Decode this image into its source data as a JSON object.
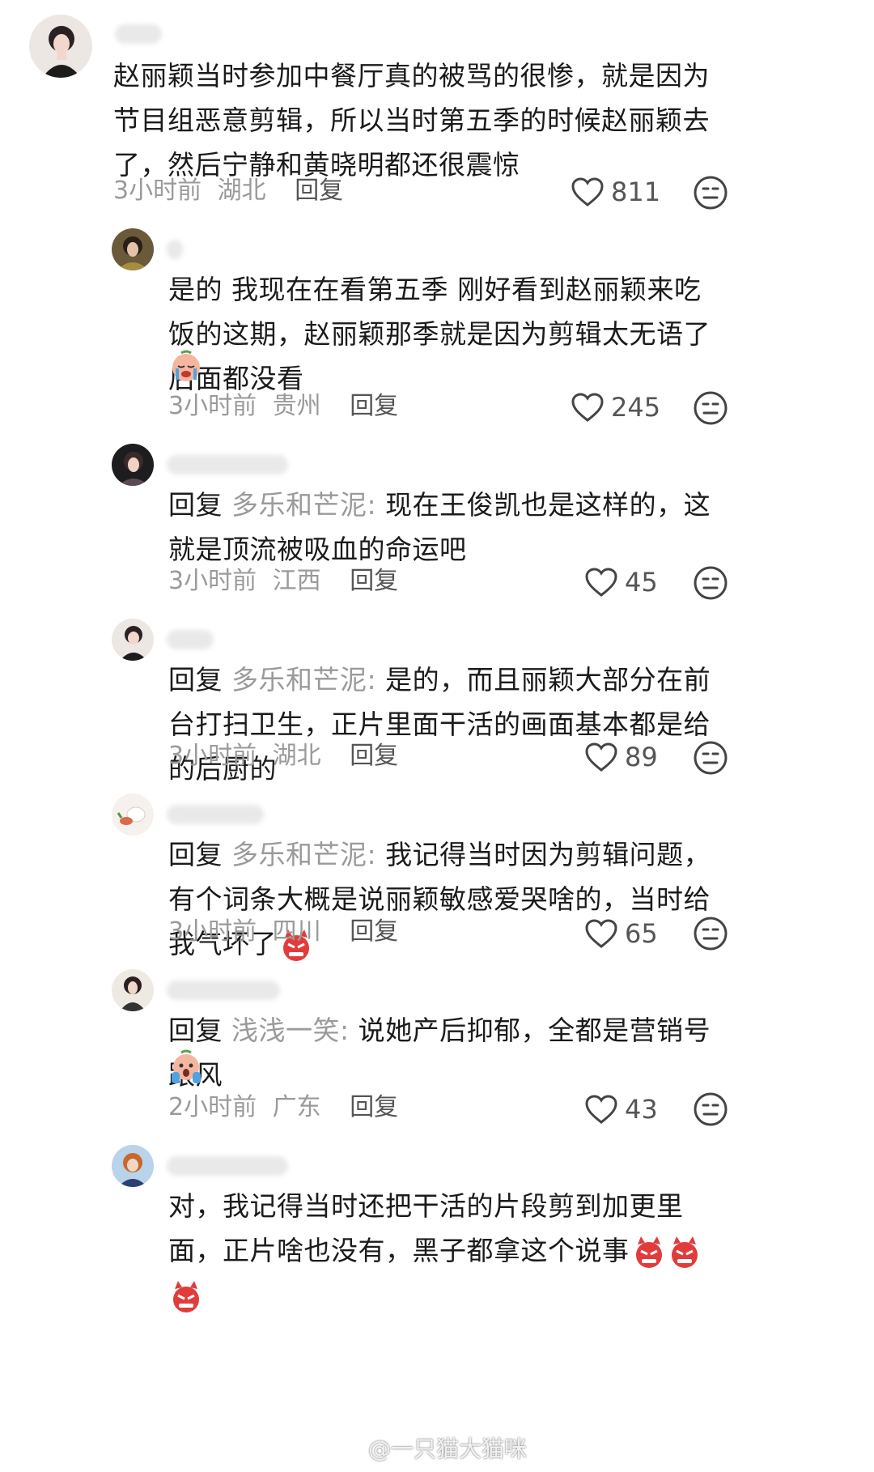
{
  "comments": [
    {
      "text": "赵丽颖当时参加中餐厅真的被骂的很惨，就是因为节目组恶意剪辑，所以当时第五季的时候赵丽颖去了，然后宁静和黄晓明都还很震惊",
      "time": "3小时前",
      "region": "湖北",
      "reply_label": "回复",
      "likes": "811"
    },
    {
      "text": "是的 我现在在看第五季 刚好看到赵丽颖来吃饭的这期，赵丽颖那季就是因为剪辑太无语了后面都没看",
      "emoji": "crying-face",
      "time": "3小时前",
      "region": "贵州",
      "reply_label": "回复",
      "likes": "245"
    },
    {
      "prefix": "回复 ",
      "reply_to": "多乐和芒泥:",
      "text": " 现在王俊凯也是这样的，这就是顶流被吸血的命运吧",
      "time": "3小时前",
      "region": "江西",
      "reply_label": "回复",
      "likes": "45"
    },
    {
      "prefix": "回复 ",
      "reply_to": "多乐和芒泥:",
      "text": " 是的，而且丽颖大部分在前台打扫卫生，正片里面干活的画面基本都是给的后厨的",
      "time": "3小时前",
      "region": "湖北",
      "reply_label": "回复",
      "likes": "89"
    },
    {
      "prefix": "回复 ",
      "reply_to": "多乐和芒泥:",
      "text": " 我记得当时因为剪辑问题，有个词条大概是说丽颖敏感爱哭啥的，当时给我气坏了",
      "emoji": "angry-devil",
      "time": "3小时前",
      "region": "四川",
      "reply_label": "回复",
      "likes": "65"
    },
    {
      "prefix": "回复 ",
      "reply_to": "浅浅一笑:",
      "text": " 说她产后抑郁，全都是营销号跟风",
      "emoji": "scared-face",
      "time": "2小时前",
      "region": "广东",
      "reply_label": "回复",
      "likes": "43"
    },
    {
      "text": "对，我记得当时还把干活的片段剪到加更里面，正片啥也没有，黑子都拿这个说事",
      "emoji": "angry-devil x3"
    }
  ],
  "watermark": "@一只猫大猫咪",
  "colors": {
    "text": "#1b1b1b",
    "meta": "#9a9a9a",
    "reply_target": "#9a9a9a",
    "angry": "#e23b3b"
  }
}
